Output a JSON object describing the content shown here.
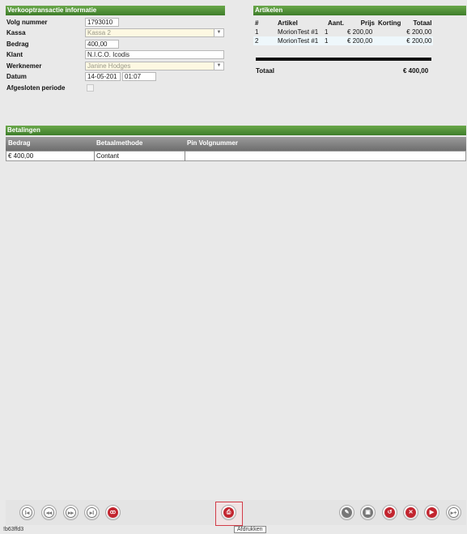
{
  "info": {
    "header": "Verkooptransactie informatie",
    "volg_label": "Volg nummer",
    "volg_value": "1793010",
    "kassa_label": "Kassa",
    "kassa_value": "Kassa 2",
    "bedrag_label": "Bedrag",
    "bedrag_value": "400,00",
    "klant_label": "Klant",
    "klant_value": "N.I.C.O. Icodis",
    "werknemer_label": "Werknemer",
    "werknemer_value": "Janine Hodges",
    "datum_label": "Datum",
    "datum_value": "14-05-201",
    "tijd_value": "01:07",
    "afgesloten_label": "Afgesloten periode"
  },
  "artikelen": {
    "header": "Artikelen",
    "columns": [
      "#",
      "Artikel",
      "Aant.",
      "Prijs",
      "Korting",
      "Totaal"
    ],
    "rows": [
      [
        "1",
        "MorionTest #1",
        "1",
        "€ 200,00",
        "",
        "€ 200,00"
      ],
      [
        "2",
        "MorionTest #1",
        "1",
        "€ 200,00",
        "",
        "€ 200,00"
      ]
    ],
    "totaal_label": "Totaal",
    "totaal_value": "€ 400,00"
  },
  "betalingen": {
    "header": "Betalingen",
    "columns": [
      "Bedrag",
      "Betaalmethode",
      "Pin Volgnummer"
    ],
    "rows": [
      [
        "€ 400,00",
        "Contant",
        ""
      ]
    ]
  },
  "toolbar": {
    "left": [
      {
        "icon": "first-icon",
        "glyph": "I◂"
      },
      {
        "icon": "previous-icon",
        "glyph": "◂◂"
      },
      {
        "icon": "next-icon",
        "glyph": "▸▸"
      },
      {
        "icon": "last-icon",
        "glyph": "▸I"
      },
      {
        "icon": "binoculars-icon",
        "glyph": "ꝏ"
      }
    ],
    "print_icon": "printer-icon",
    "print_tooltip": "Afdrukken",
    "right": [
      {
        "icon": "edit-icon",
        "glyph": "✎"
      },
      {
        "icon": "save-icon",
        "glyph": "▣"
      },
      {
        "icon": "undo-icon",
        "glyph": "↺"
      },
      {
        "icon": "delete-icon",
        "glyph": "✕"
      },
      {
        "icon": "play-icon",
        "glyph": "▶"
      },
      {
        "icon": "step-forward-icon",
        "glyph": "▸+"
      }
    ]
  },
  "status_text": "!b63ffd3",
  "colors": {
    "header_green": "#4f9437",
    "danger_red": "#c2252f",
    "gray": "#777777"
  }
}
